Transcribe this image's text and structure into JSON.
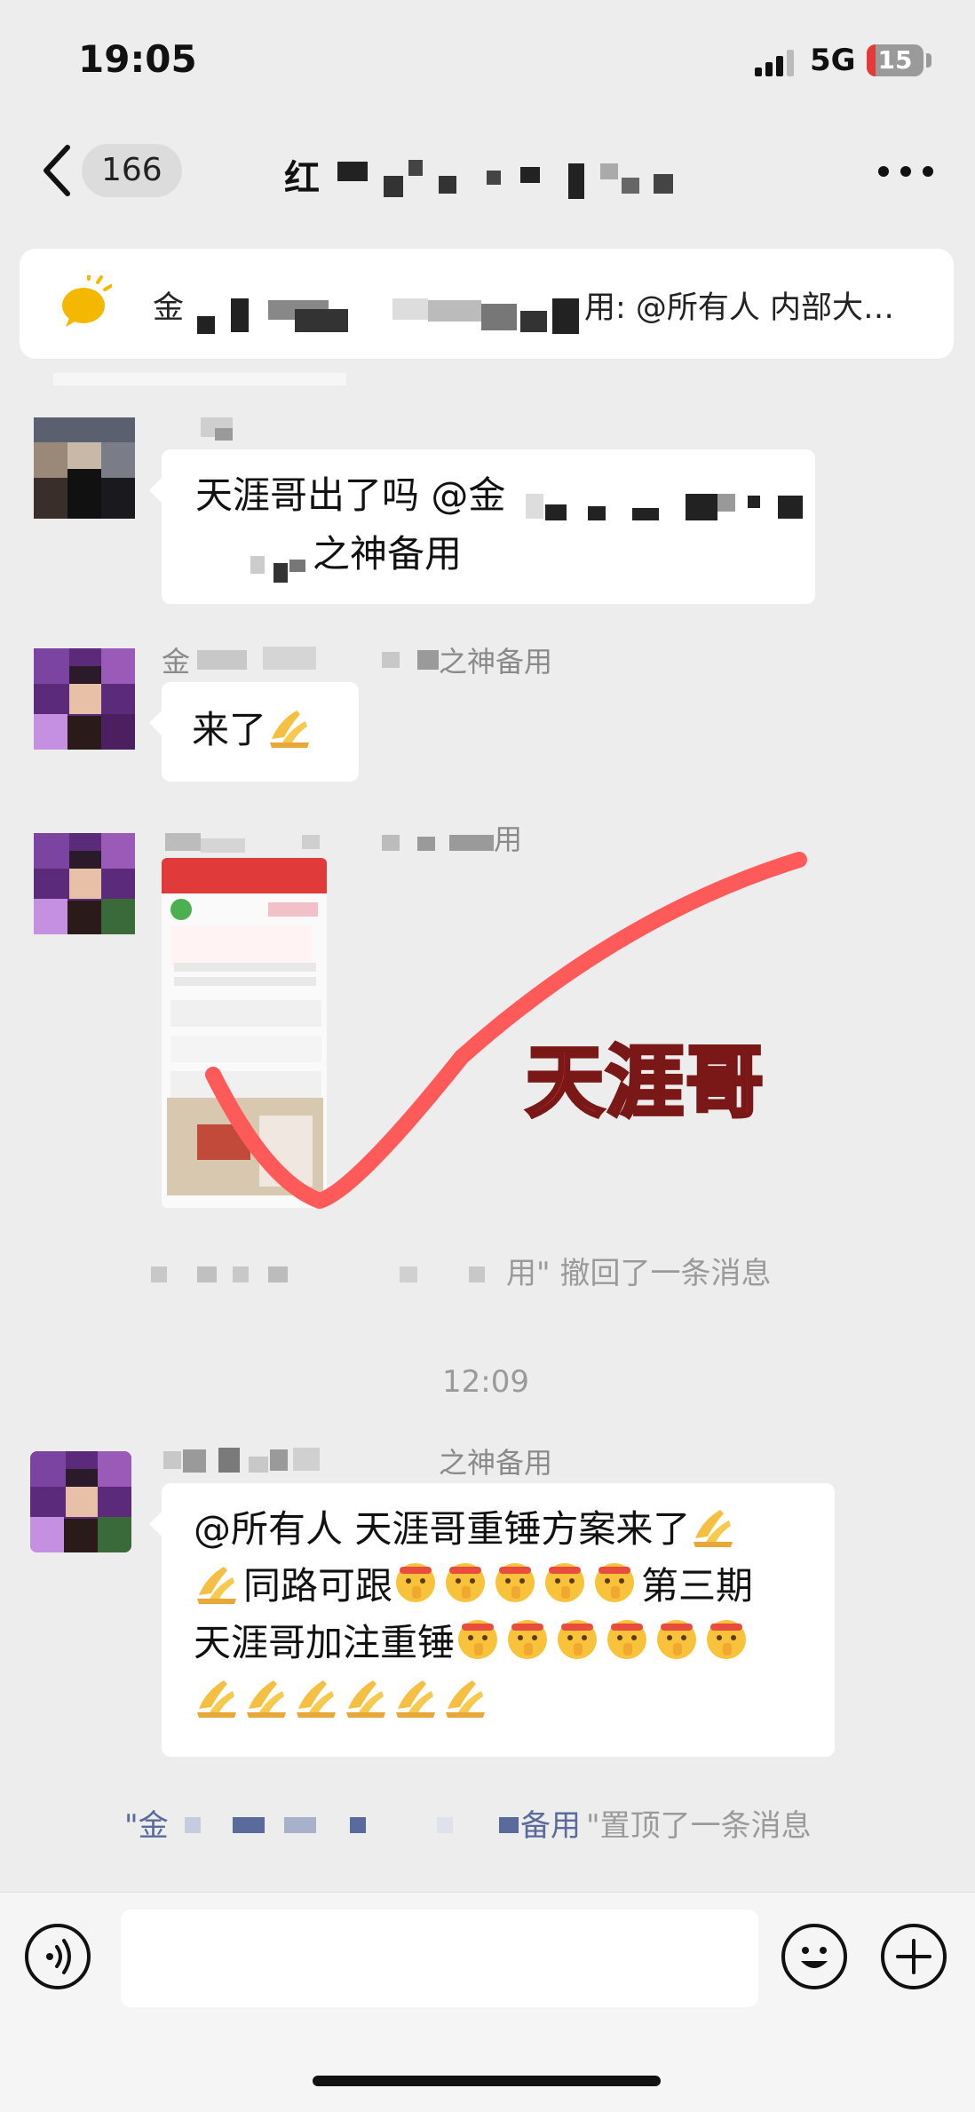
{
  "status_bar": {
    "time": "19:05",
    "network": "5G",
    "battery": "15",
    "battery_level": 0.15
  },
  "nav": {
    "unread_count": "166",
    "title": "红"
  },
  "notice": {
    "sender_prefix": "金",
    "text": "用: @所有人 内部大…"
  },
  "messages": [
    {
      "name": "",
      "text_line1": "天涯哥出了吗 @金",
      "text_line2": "之神备用"
    },
    {
      "name_suffix": "之神备用",
      "text": "来了"
    },
    {
      "name_suffix": "用"
    },
    {
      "name_suffix": "之神备用",
      "lines": [
        "@所有人 天涯哥重锤方案来了",
        "同路可跟",
        "第三期",
        "天涯哥加注重锤"
      ]
    }
  ],
  "system": {
    "recall": "用\" 撤回了一条消息",
    "pin_prefix": "\"金",
    "pin_name": "备用",
    "pin_text": "\"置顶了一条消息"
  },
  "timestamp": "12:09",
  "overlay_label": "天涯哥",
  "icons": {
    "back": "chevron-left-icon",
    "more": "more-icon",
    "notice": "bell-icon",
    "voice": "voice-icon",
    "emoji": "emoji-icon",
    "plus": "plus-icon"
  },
  "colors": {
    "overlay_red": "#ff3b3b",
    "battery_red": "#e53a3a",
    "app_bg": "#ededed"
  }
}
